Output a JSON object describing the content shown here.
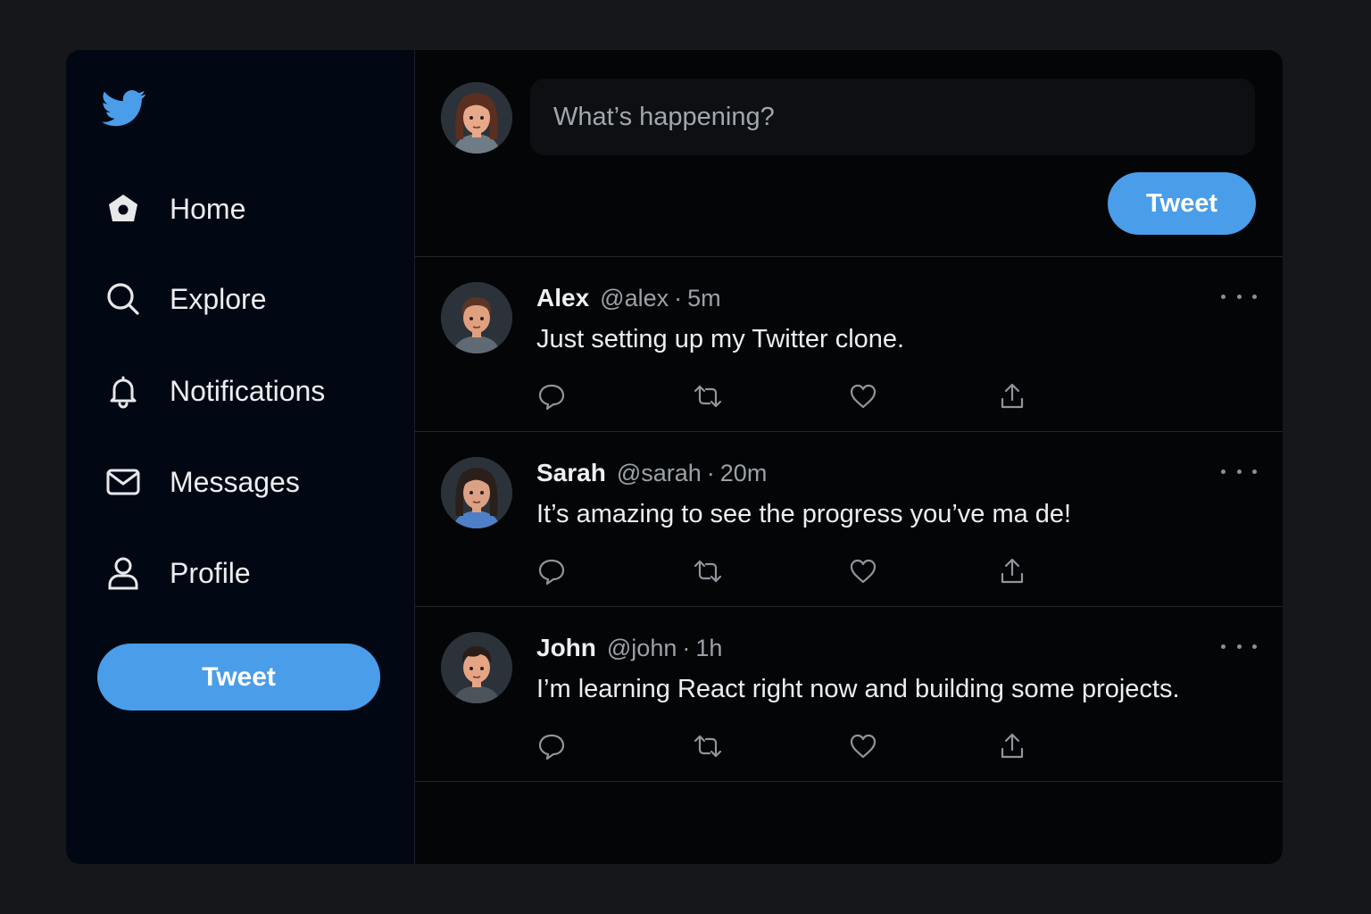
{
  "app": {
    "accent": "#4a9de9",
    "logo_icon": "bird-icon"
  },
  "sidebar": {
    "items": [
      {
        "label": "Home",
        "icon": "home-icon"
      },
      {
        "label": "Explore",
        "icon": "search-icon"
      },
      {
        "label": "Notifications",
        "icon": "bell-icon"
      },
      {
        "label": "Messages",
        "icon": "mail-icon"
      },
      {
        "label": "Profile",
        "icon": "user-icon"
      }
    ],
    "tweet_button": "Tweet"
  },
  "compose": {
    "placeholder": "What’s happening?",
    "tweet_button": "Tweet"
  },
  "feed": {
    "tweets": [
      {
        "name": "Alex",
        "handle": "@alex",
        "separator": "·",
        "time": "5m",
        "text": "Just setting up my Twitter clone."
      },
      {
        "name": "Sarah",
        "handle": "@sarah",
        "separator": "·",
        "time": "20m",
        "text": "It’s amazing to see the progress you’ve ma de!"
      },
      {
        "name": "John",
        "handle": "@john",
        "separator": "·",
        "time": "1h",
        "text": "I’m learning React right now and building some projects."
      }
    ]
  }
}
